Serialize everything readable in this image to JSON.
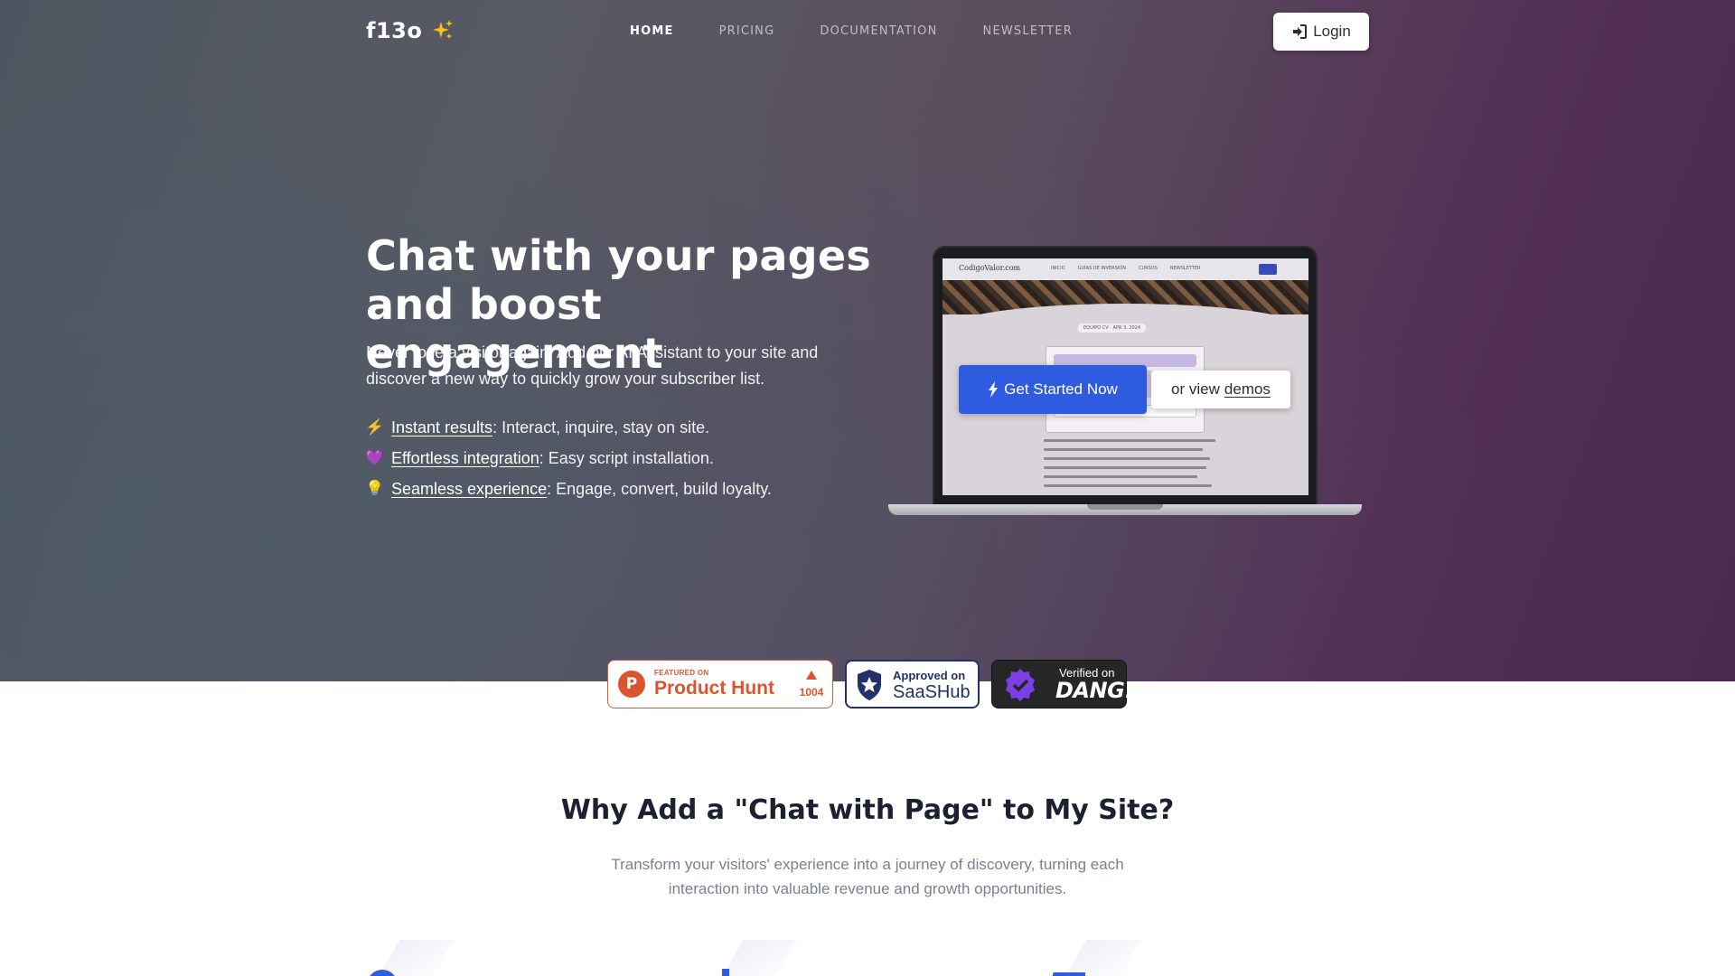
{
  "nav": {
    "logo": "f13o",
    "links": [
      "HOME",
      "PRICING",
      "DOCUMENTATION",
      "NEWSLETTER"
    ],
    "active": "HOME",
    "login_label": "Login"
  },
  "hero": {
    "title_line1": "Chat with your pages",
    "title_line2": "and boost engagement",
    "subtitle": "Never lose a visitor again. Add our AI Assistant to your site and discover a new way to quickly grow your subscriber list.",
    "features": [
      {
        "emoji": "⚡",
        "link": "Instant results",
        "text": ": Interact, inquire, stay on site."
      },
      {
        "emoji": "💜",
        "link": "Effortless integration",
        "text": ": Easy script installation."
      },
      {
        "emoji": "💡",
        "link": "Seamless experience",
        "text": ": Engage, convert, build loyalty."
      }
    ],
    "cta_primary": "Get Started Now",
    "cta_secondary_prefix": "or view",
    "cta_secondary_link": "demos"
  },
  "laptop_preview": {
    "site_name": "CodigoValor.com",
    "nav_items": [
      "INICIO",
      "GUÍAS DE INVERSIÓN",
      "CURSOS",
      "NEWSLETTER"
    ],
    "meta": "EQUIPO CV  ·  APR 3, 2024"
  },
  "badges": {
    "product_hunt": {
      "small": "FEATURED ON",
      "big": "Product Hunt",
      "count": "1004"
    },
    "saashub": {
      "small": "Approved on",
      "big": "SaaSHub"
    },
    "dang": {
      "small": "Verified on",
      "big": "DANG!"
    }
  },
  "why": {
    "title": "Why Add a \"Chat with Page\" to My Site?",
    "subtitle": "Transform your visitors' experience into a journey of discovery, turning each interaction into valuable revenue and growth opportunities."
  },
  "colors": {
    "accent_blue": "#2f5be0",
    "product_hunt": "#da552f",
    "saashub": "#24306b",
    "dang_purple": "#7b3fe4",
    "spark_yellow": "#f5c518"
  }
}
